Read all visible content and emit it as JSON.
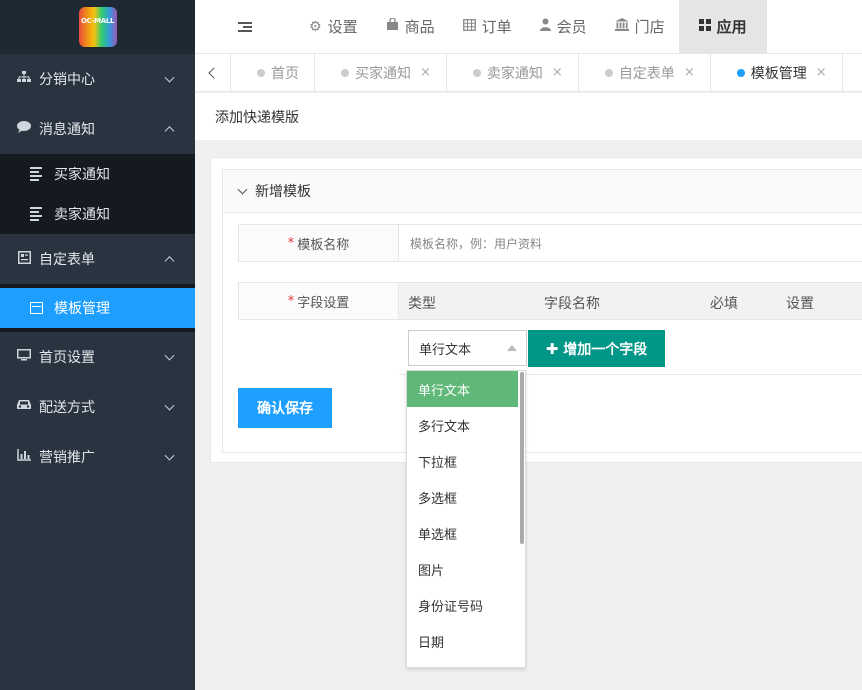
{
  "logo": {
    "text": "OC-MALL"
  },
  "sidebar": {
    "items": [
      {
        "label": "分销中心",
        "icon": "sitemap-icon",
        "expanded": false
      },
      {
        "label": "消息通知",
        "icon": "comment-icon",
        "expanded": true,
        "children": [
          {
            "label": "买家通知"
          },
          {
            "label": "卖家通知"
          }
        ]
      },
      {
        "label": "自定表单",
        "icon": "form-icon",
        "expanded": true,
        "children": [
          {
            "label": "模板管理",
            "active": true
          }
        ]
      },
      {
        "label": "首页设置",
        "icon": "monitor-icon",
        "expanded": false
      },
      {
        "label": "配送方式",
        "icon": "car-icon",
        "expanded": false
      },
      {
        "label": "营销推广",
        "icon": "bar-chart-icon",
        "expanded": false
      }
    ]
  },
  "topnav": {
    "items": [
      {
        "label": "设置",
        "icon": "gears-icon"
      },
      {
        "label": "商品",
        "icon": "shopping-bag-icon"
      },
      {
        "label": "订单",
        "icon": "table-icon"
      },
      {
        "label": "会员",
        "icon": "user-icon"
      },
      {
        "label": "门店",
        "icon": "bank-icon"
      },
      {
        "label": "应用",
        "icon": "apps-icon",
        "active": true
      }
    ]
  },
  "tabs": [
    {
      "label": "首页",
      "closable": false
    },
    {
      "label": "买家通知",
      "closable": true
    },
    {
      "label": "卖家通知",
      "closable": true
    },
    {
      "label": "自定表单",
      "closable": true
    },
    {
      "label": "模板管理",
      "closable": true,
      "active": true
    }
  ],
  "tab_close_glyph": "×",
  "page": {
    "title": "添加快递模版"
  },
  "card": {
    "title": "新增模板",
    "template_name_label": "模板名称",
    "template_name_placeholder": "模板名称，例：用户资料",
    "field_settings_label": "字段设置",
    "required_mark": "*",
    "table_headers": {
      "type": "类型",
      "field_name": "字段名称",
      "required": "必填",
      "settings": "设置"
    },
    "select_value": "单行文本",
    "add_field_label": "增加一个字段",
    "save_label": "确认保存"
  },
  "dropdown": {
    "options": [
      "单行文本",
      "多行文本",
      "下拉框",
      "多选框",
      "单选框",
      "图片",
      "身份证号码",
      "日期"
    ],
    "selected_index": 0
  },
  "colors": {
    "primary": "#1e9fff",
    "teal": "#009688",
    "green_selected": "#5fb878",
    "sidebar_bg": "#2a3440",
    "required": "#e4393c"
  }
}
